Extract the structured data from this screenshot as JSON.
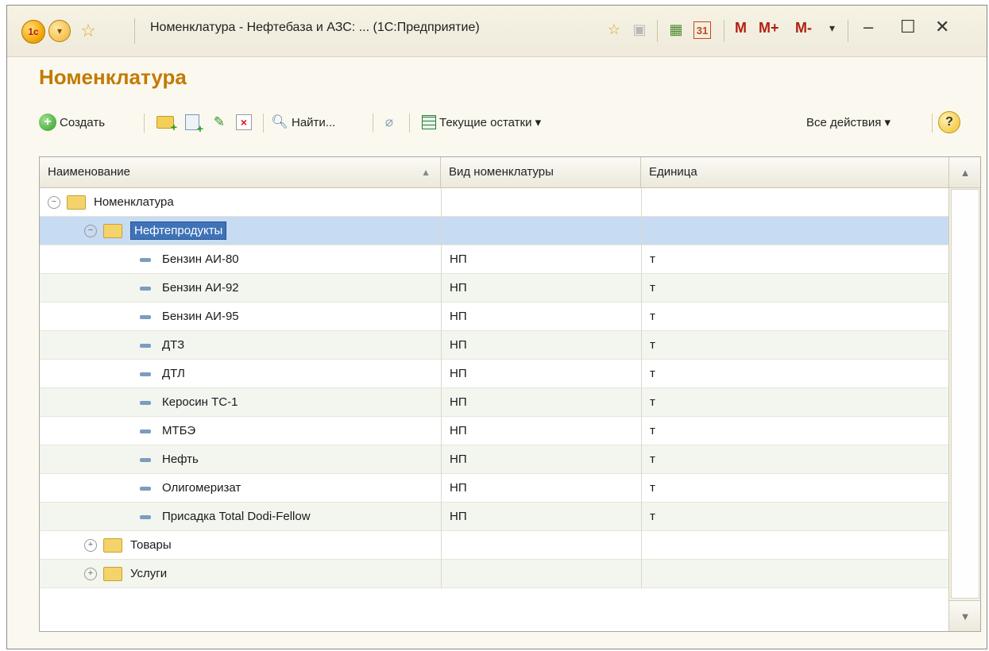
{
  "window": {
    "title": "Номенклатура - Нефтебаза и АЗС: ...  (1С:Предприятие)",
    "logo_text": "1с",
    "mem_buttons": [
      "M",
      "M+",
      "M-"
    ]
  },
  "page": {
    "heading": "Номенклатура"
  },
  "toolbar": {
    "create_label": "Создать",
    "find_label": "Найти...",
    "stock_label": "Текущие остатки ▾",
    "all_actions_label": "Все действия ▾",
    "help_label": "?"
  },
  "table": {
    "columns": [
      "Наименование",
      "Вид номенклатуры",
      "Единица"
    ],
    "rows": [
      {
        "name": "Номенклатура",
        "kind": "",
        "unit": "",
        "type": "group",
        "level": 0,
        "expander": "⊖"
      },
      {
        "name": "Нефтепродукты",
        "kind": "",
        "unit": "",
        "type": "group",
        "level": 1,
        "expander": "⊖",
        "selected": true
      },
      {
        "name": "Бензин АИ-80",
        "kind": "НП",
        "unit": "т",
        "type": "item",
        "level": 2
      },
      {
        "name": "Бензин АИ-92",
        "kind": "НП",
        "unit": "т",
        "type": "item",
        "level": 2
      },
      {
        "name": "Бензин АИ-95",
        "kind": "НП",
        "unit": "т",
        "type": "item",
        "level": 2
      },
      {
        "name": "ДТЗ",
        "kind": "НП",
        "unit": "т",
        "type": "item",
        "level": 2
      },
      {
        "name": "ДТЛ",
        "kind": "НП",
        "unit": "т",
        "type": "item",
        "level": 2
      },
      {
        "name": "Керосин ТС-1",
        "kind": "НП",
        "unit": "т",
        "type": "item",
        "level": 2
      },
      {
        "name": "МТБЭ",
        "kind": "НП",
        "unit": "т",
        "type": "item",
        "level": 2
      },
      {
        "name": "Нефть",
        "kind": "НП",
        "unit": "т",
        "type": "item",
        "level": 2
      },
      {
        "name": "Олигомеризат",
        "kind": "НП",
        "unit": "т",
        "type": "item",
        "level": 2
      },
      {
        "name": "Присадка Total Dodi-Fellow",
        "kind": "НП",
        "unit": "т",
        "type": "item",
        "level": 2
      },
      {
        "name": "Товары",
        "kind": "",
        "unit": "",
        "type": "group",
        "level": 1,
        "expander": "⊕"
      },
      {
        "name": "Услуги",
        "kind": "",
        "unit": "",
        "type": "group",
        "level": 1,
        "expander": "⊕"
      }
    ]
  },
  "colors": {
    "heading": "#c27a00",
    "selected_row": "#c7dbf2",
    "alt_row": "#f2f6ee"
  }
}
